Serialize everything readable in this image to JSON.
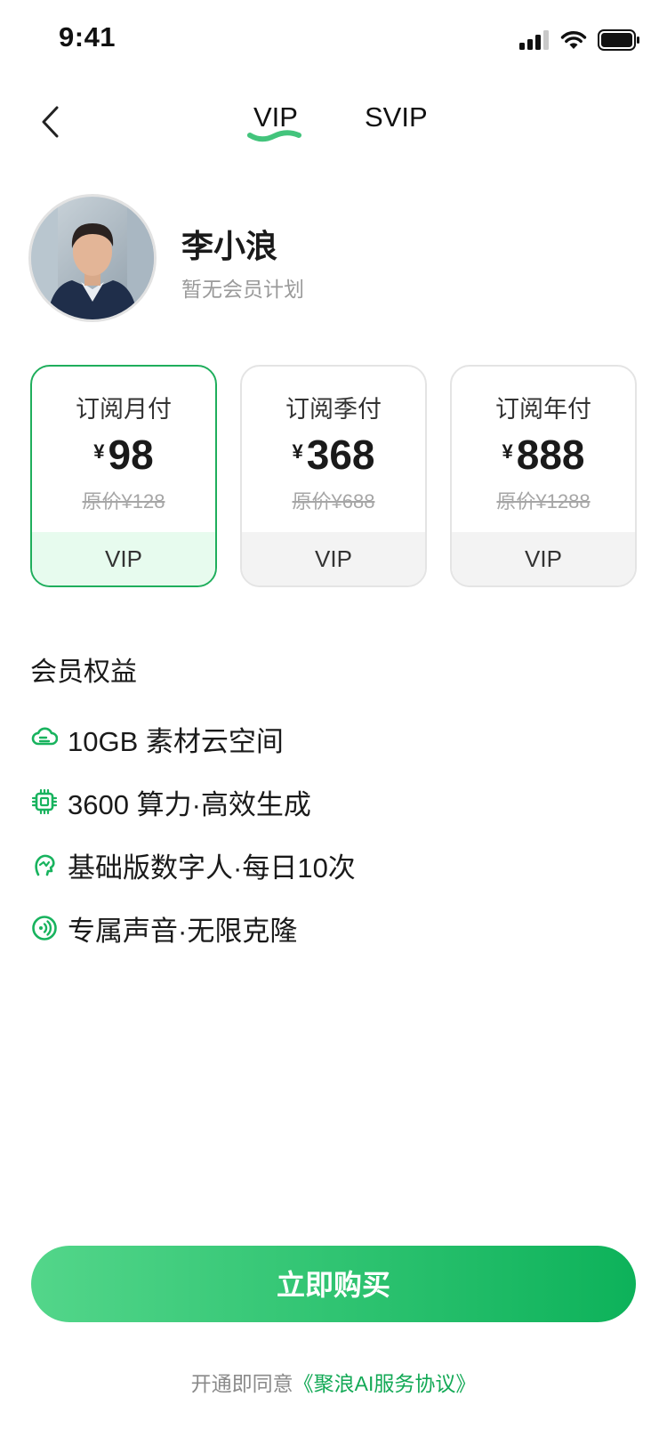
{
  "status_bar": {
    "time": "9:41"
  },
  "header": {
    "tabs": [
      {
        "label": "VIP"
      },
      {
        "label": "SVIP"
      }
    ],
    "accent_color": "#1fae5c"
  },
  "profile": {
    "name": "李小浪",
    "plan_status": "暂无会员计划"
  },
  "plans": [
    {
      "title": "订阅月付",
      "currency": "¥",
      "price": "98",
      "original": "原价¥128",
      "tier": "VIP",
      "selected": true
    },
    {
      "title": "订阅季付",
      "currency": "¥",
      "price": "368",
      "original": "原价¥688",
      "tier": "VIP",
      "selected": false
    },
    {
      "title": "订阅年付",
      "currency": "¥",
      "price": "888",
      "original": "原价¥1288",
      "tier": "VIP",
      "selected": false
    }
  ],
  "benefits": {
    "title": "会员权益",
    "items": [
      {
        "icon": "cloud-storage-icon",
        "text": "10GB 素材云空间"
      },
      {
        "icon": "chip-icon",
        "text": "3600 算力·高效生成"
      },
      {
        "icon": "digital-human-icon",
        "text": "基础版数字人·每日10次"
      },
      {
        "icon": "voice-icon",
        "text": "专属声音·无限克隆"
      }
    ]
  },
  "cta": {
    "label": "立即购买"
  },
  "agreement": {
    "prefix": "开通即同意",
    "link": "《聚浪AI服务协议》"
  }
}
